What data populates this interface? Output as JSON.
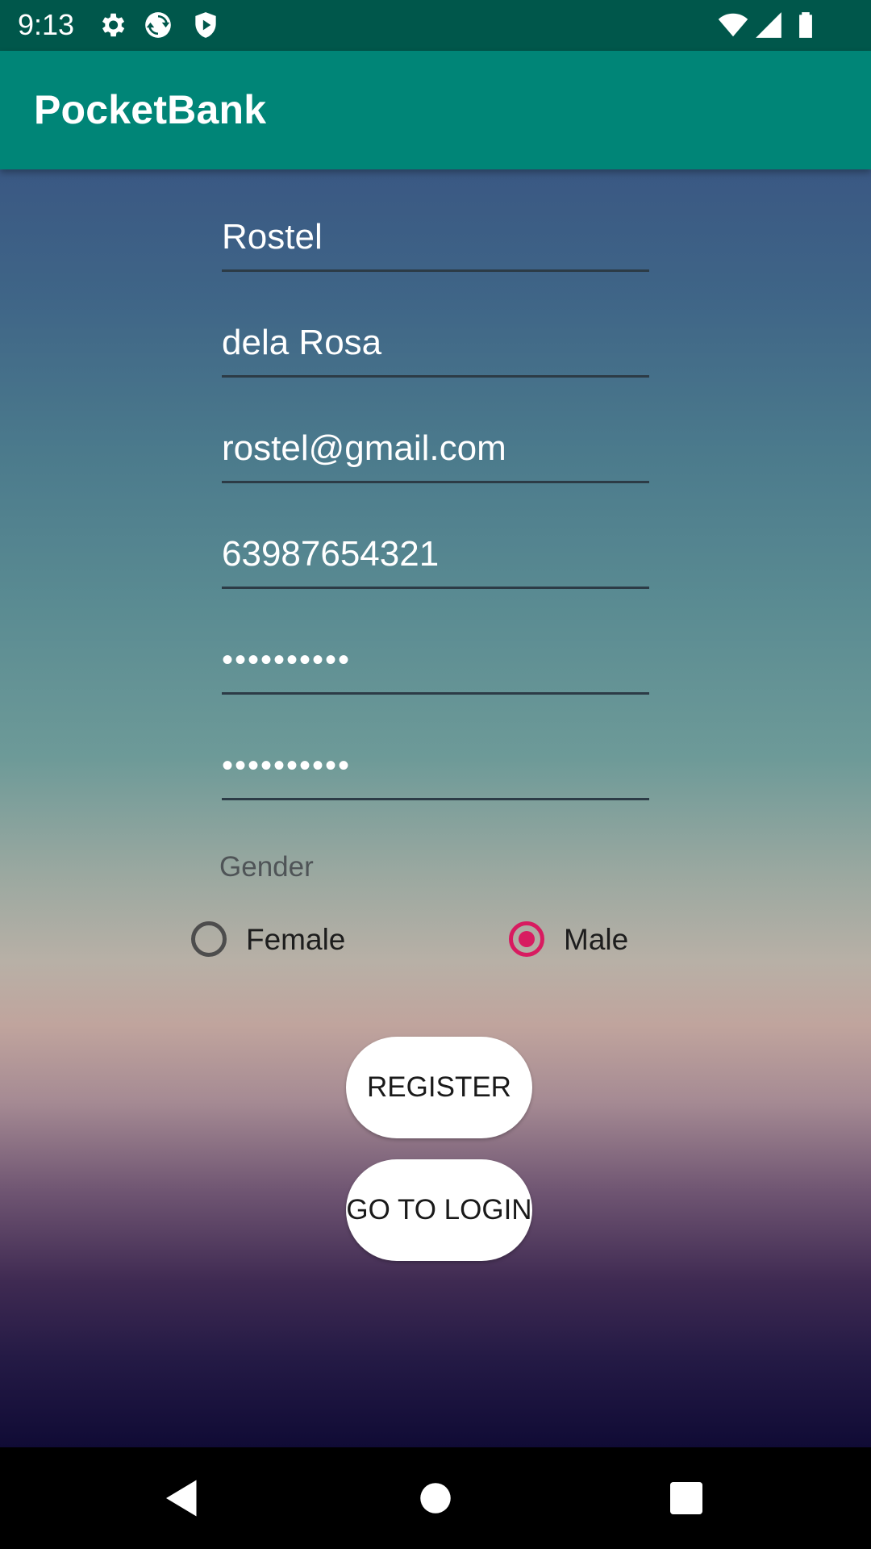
{
  "status_bar": {
    "time": "9:13",
    "icons_left": [
      "gear-icon",
      "sync-icon",
      "shield-icon"
    ],
    "icons_right": [
      "wifi-icon",
      "cellular-signal-icon",
      "battery-icon"
    ]
  },
  "app_bar": {
    "title": "PocketBank",
    "color": "#008577"
  },
  "form": {
    "first_name": "Rostel",
    "last_name": "dela Rosa",
    "email": "rostel@gmail.com",
    "phone": "63987654321",
    "password": "••••••••••",
    "confirm_password": "••••••••••",
    "gender_label": "Gender",
    "gender_options": [
      {
        "label": "Female",
        "checked": false
      },
      {
        "label": "Male",
        "checked": true
      }
    ],
    "register_label": "REGISTER",
    "go_to_login_label": "GO TO LOGIN"
  },
  "colors": {
    "accent": "#d81b60",
    "status_bar": "#00574b"
  },
  "nav_bar": {
    "buttons": [
      "back-icon",
      "home-icon",
      "recents-icon"
    ]
  }
}
